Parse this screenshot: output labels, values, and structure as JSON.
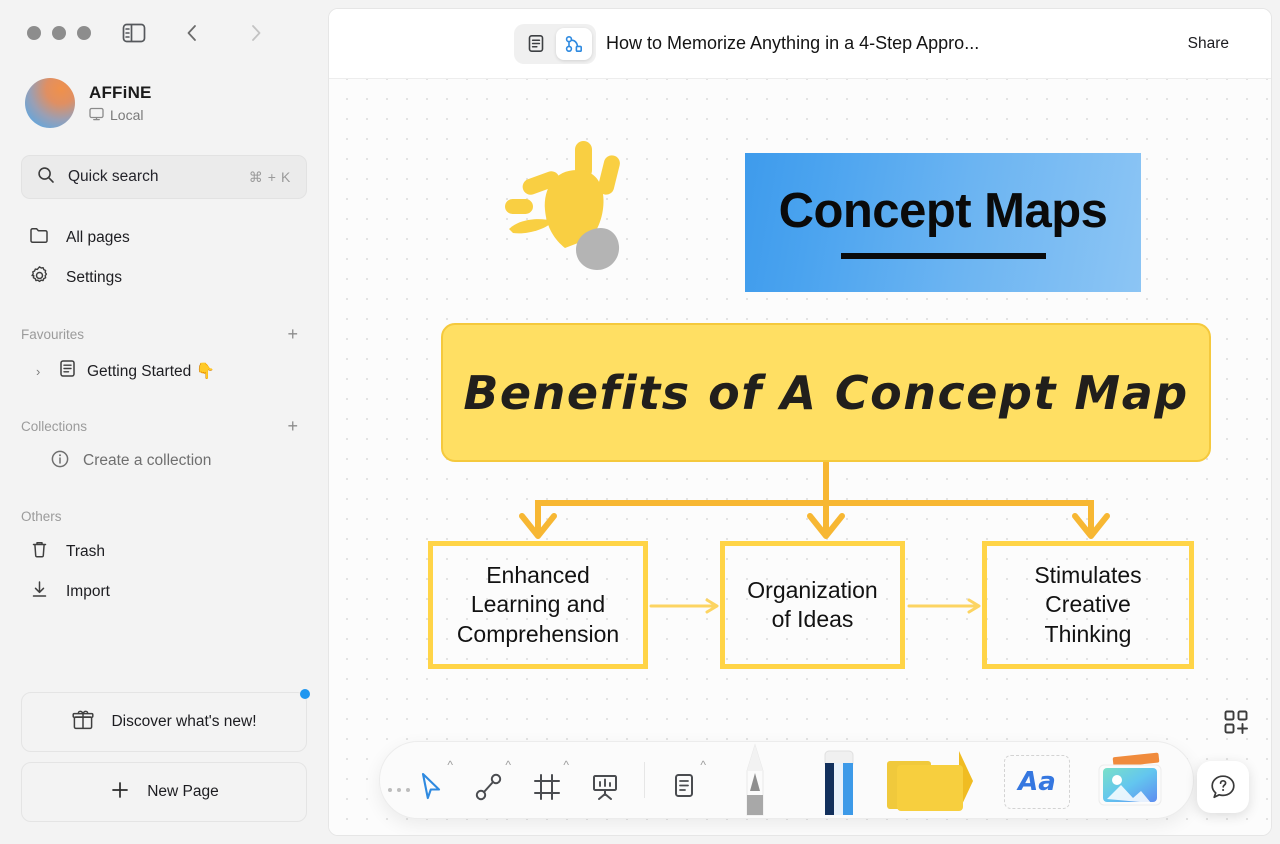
{
  "window": {
    "traffic_lights": [
      "close",
      "minimize",
      "maximize"
    ],
    "sidebar_toggle_icon": "sidebar-toggle-icon",
    "nav_back_icon": "chevron-left-icon",
    "nav_forward_icon": "chevron-right-icon"
  },
  "sidebar": {
    "workspace": {
      "name": "AFFiNE",
      "sync_label": "Local",
      "sync_icon": "monitor-icon",
      "avatar_icon": "workspace-avatar"
    },
    "search": {
      "label": "Quick search",
      "shortcut": "⌘ + K",
      "icon": "search-icon"
    },
    "nav": [
      {
        "label": "All pages",
        "icon": "folder-icon"
      },
      {
        "label": "Settings",
        "icon": "gear-icon"
      }
    ],
    "favourites": {
      "title": "Favourites",
      "add_label": "+",
      "items": [
        {
          "label": "Getting Started 👇",
          "icon": "page-icon",
          "caret": "›"
        }
      ]
    },
    "collections": {
      "title": "Collections",
      "add_label": "+",
      "items": [
        {
          "label": "Create a collection",
          "icon": "info-icon"
        }
      ]
    },
    "others": {
      "title": "Others",
      "items": [
        {
          "label": "Trash",
          "icon": "trash-icon"
        },
        {
          "label": "Import",
          "icon": "import-icon"
        }
      ]
    },
    "bottom": {
      "discover_label": "Discover what's new!",
      "discover_icon": "gift-icon",
      "has_badge": true,
      "new_page_label": "New Page",
      "new_page_icon": "plus-icon"
    }
  },
  "header": {
    "mode_page_icon": "page-mode-icon",
    "mode_edgeless_icon": "edgeless-mode-icon",
    "active_mode": "edgeless",
    "doc_title": "How to Memorize Anything in a 4-Step Appro...",
    "title_caret_icon": "chevron-down-icon",
    "share_label": "Share"
  },
  "canvas": {
    "banner": {
      "text": "Concept Maps",
      "gradient_from": "#3e9bec",
      "gradient_to": "#8cc5f4"
    },
    "bulb_icon": "lightbulb-icon",
    "title_card": {
      "text": "Benefits of A Concept Map",
      "fill": "#ffdf63",
      "border": "#f5c93d"
    },
    "nodes": [
      {
        "text": "Enhanced\nLearning and\nComprehension",
        "border": "#ffd447"
      },
      {
        "text": "Organization\nof Ideas",
        "border": "#ffd447"
      },
      {
        "text": "Stimulates\nCreative\nThinking",
        "border": "#ffd447"
      }
    ],
    "connector_color": "#f7b733"
  },
  "toolbar": {
    "tools": [
      {
        "name": "select-tool",
        "icon": "cursor-icon",
        "active": true,
        "has_chevron": true
      },
      {
        "name": "connector-tool",
        "icon": "connector-icon",
        "active": false,
        "has_chevron": true
      },
      {
        "name": "frame-tool",
        "icon": "frame-icon",
        "active": false,
        "has_chevron": true
      },
      {
        "name": "present-tool",
        "icon": "presentation-icon",
        "active": false,
        "has_chevron": false
      },
      {
        "name": "note-tool",
        "icon": "note-icon",
        "active": false,
        "has_chevron": true
      }
    ],
    "media_tools": [
      {
        "name": "pen-tool",
        "icon": "pencil-icon"
      },
      {
        "name": "eraser-tool",
        "icon": "eraser-icon"
      },
      {
        "name": "sticky-note-tool",
        "icon": "sticky-note-icon"
      },
      {
        "name": "text-tool",
        "icon": "text-aa-icon",
        "label": "Aa"
      },
      {
        "name": "image-tool",
        "icon": "image-icon"
      }
    ],
    "template_icon": "template-add-icon",
    "help_icon": "help-question-icon"
  }
}
